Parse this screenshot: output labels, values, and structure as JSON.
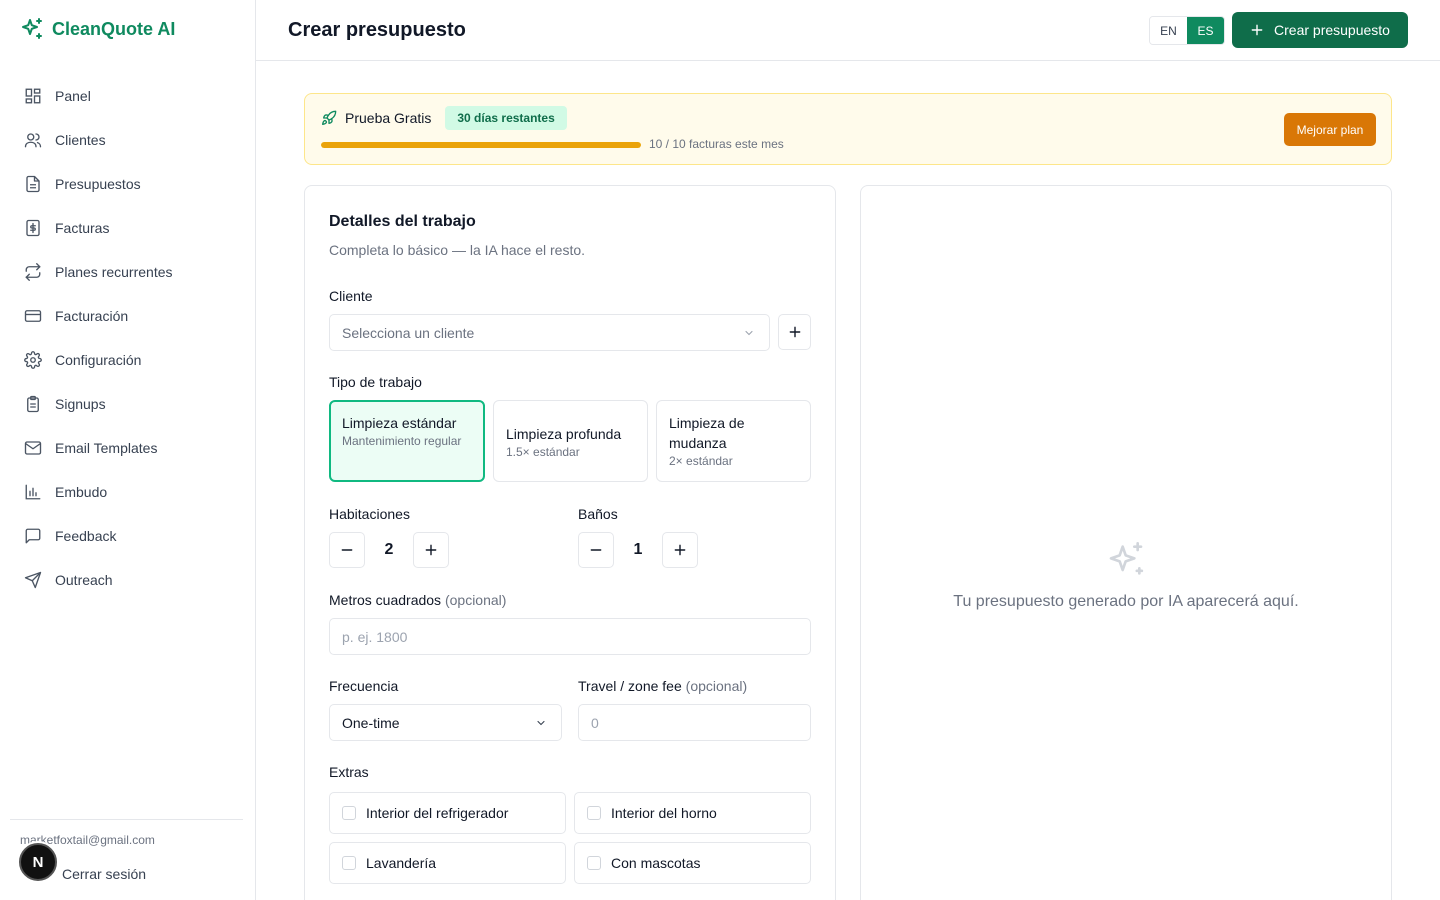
{
  "brand": {
    "name": "CleanQuote AI",
    "color": "#0f8a5f"
  },
  "sidebar": {
    "items": [
      {
        "label": "Panel",
        "icon": "dashboard-icon"
      },
      {
        "label": "Clientes",
        "icon": "users-icon"
      },
      {
        "label": "Presupuestos",
        "icon": "document-icon"
      },
      {
        "label": "Facturas",
        "icon": "invoice-dollar-icon"
      },
      {
        "label": "Planes recurrentes",
        "icon": "repeat-icon"
      },
      {
        "label": "Facturación",
        "icon": "credit-card-icon"
      },
      {
        "label": "Configuración",
        "icon": "gear-icon"
      },
      {
        "label": "Signups",
        "icon": "clipboard-icon"
      },
      {
        "label": "Email Templates",
        "icon": "mail-icon"
      },
      {
        "label": "Embudo",
        "icon": "bar-chart-icon"
      },
      {
        "label": "Feedback",
        "icon": "message-icon"
      },
      {
        "label": "Outreach",
        "icon": "send-icon"
      }
    ],
    "email": "marketfoxtail@gmail.com",
    "logout": "Cerrar sesión",
    "avatar_letter": "N"
  },
  "header": {
    "title": "Crear presupuesto",
    "lang_en": "EN",
    "lang_es": "ES",
    "create_button": "Crear presupuesto"
  },
  "trial": {
    "label": "Prueba Gratis",
    "badge": "30 días restantes",
    "progress": 1.0,
    "count": "10 / 10 facturas este mes",
    "upgrade": "Mejorar plan"
  },
  "form": {
    "title": "Detalles del trabajo",
    "subtitle": "Completa lo básico — la IA hace el resto.",
    "client_label": "Cliente",
    "client_placeholder": "Selecciona un cliente",
    "job_type_label": "Tipo de trabajo",
    "job_types": [
      {
        "name": "Limpieza estándar",
        "desc": "Mantenimiento regular"
      },
      {
        "name": "Limpieza profunda",
        "desc": "1.5× estándar"
      },
      {
        "name": "Limpieza de mudanza",
        "desc": "2× estándar"
      }
    ],
    "rooms_label": "Habitaciones",
    "rooms_value": "2",
    "baths_label": "Baños",
    "baths_value": "1",
    "sqft_label": "Metros cuadrados",
    "optional": "(opcional)",
    "sqft_placeholder": "p. ej. 1800",
    "frequency_label": "Frecuencia",
    "frequency_value": "One-time",
    "travel_label": "Travel / zone fee",
    "travel_placeholder": "0",
    "extras_label": "Extras",
    "extras": [
      "Interior del refrigerador",
      "Interior del horno",
      "Lavandería",
      "Con mascotas"
    ]
  },
  "preview": {
    "empty_text": "Tu presupuesto generado por IA aparecerá aquí."
  }
}
